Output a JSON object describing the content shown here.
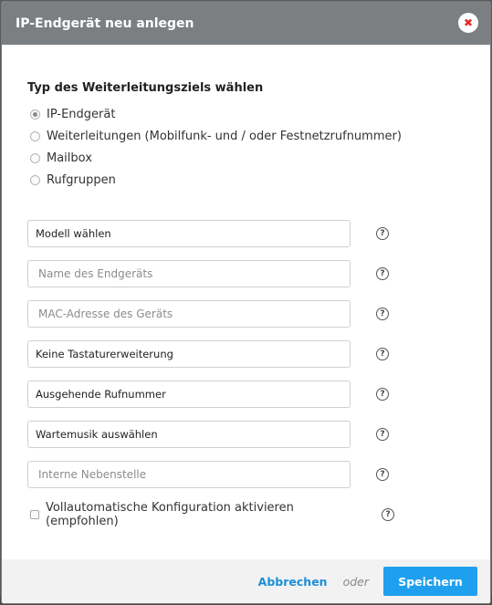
{
  "dialog": {
    "title": "IP-Endgerät neu anlegen",
    "close_icon": "close-icon"
  },
  "target_type": {
    "title": "Typ des Weiterleitungsziels wählen",
    "selected": "IP-Endgerät",
    "options": [
      {
        "label": "IP-Endgerät"
      },
      {
        "label": "Weiterleitungen (Mobilfunk- und / oder Festnetzrufnummer)"
      },
      {
        "label": "Mailbox"
      },
      {
        "label": "Rufgruppen"
      }
    ]
  },
  "fields": {
    "model": {
      "value": "Modell wählen"
    },
    "device_name": {
      "placeholder": "Name des Endgeräts"
    },
    "mac_address": {
      "placeholder": "MAC-Adresse des Geräts"
    },
    "keyboard_extension": {
      "value": "Keine Tastaturerweiterung"
    },
    "outgoing_number": {
      "value": "Ausgehende Rufnummer"
    },
    "hold_music": {
      "value": "Wartemusik auswählen"
    },
    "internal_extension": {
      "placeholder": "Interne Nebenstelle"
    }
  },
  "help_icon_glyph": "?",
  "auto_config": {
    "label": "Vollautomatische Konfiguration aktivieren (empfohlen)",
    "checked": false
  },
  "footer": {
    "cancel_label": "Abbrechen",
    "or_label": "oder",
    "save_label": "Speichern"
  },
  "colors": {
    "header_bg": "#7b7f82",
    "accent": "#1fa0ef",
    "link": "#1a8fd8",
    "close": "#e02b2b"
  }
}
